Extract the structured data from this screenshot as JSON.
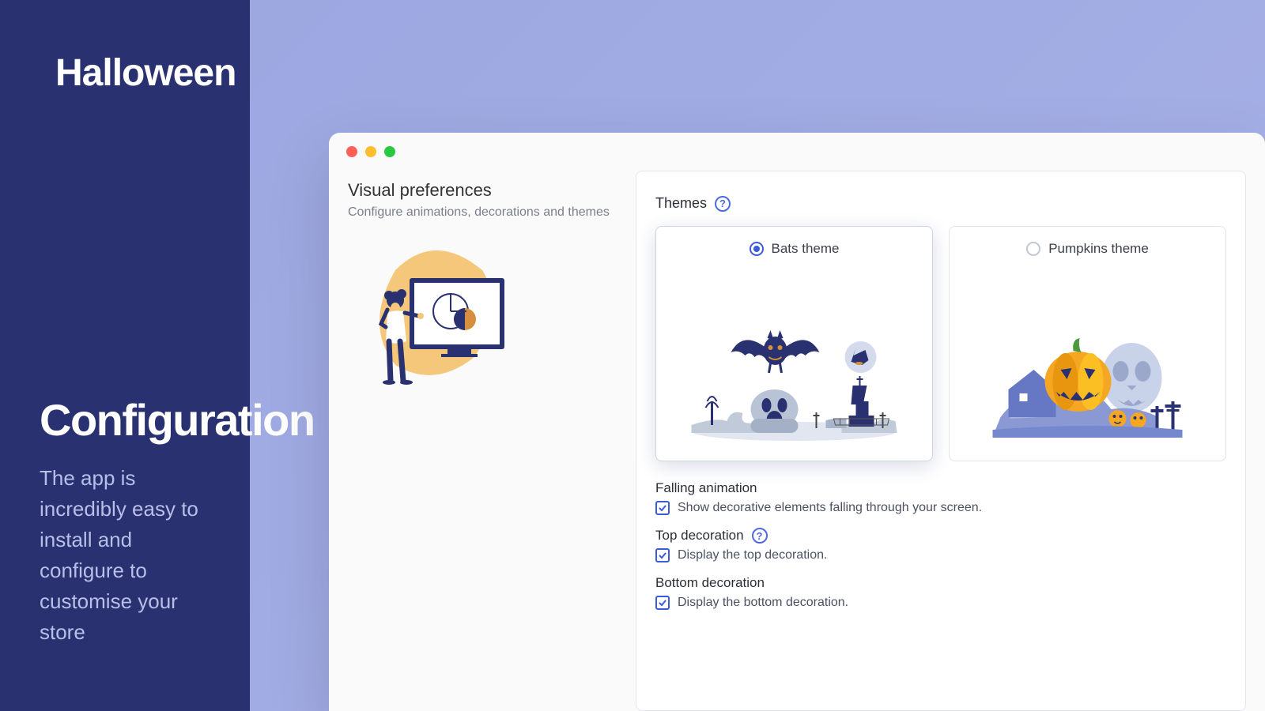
{
  "brand": {
    "title": "Halloween"
  },
  "config": {
    "title": "Configuration",
    "description": "The app is incredibly easy to install and configure to customise your store"
  },
  "visualPrefs": {
    "title": "Visual preferences",
    "subtitle": "Configure animations, decorations and themes"
  },
  "panel": {
    "themesLabel": "Themes",
    "themes": [
      {
        "label": "Bats theme",
        "selected": true
      },
      {
        "label": "Pumpkins theme",
        "selected": false
      }
    ],
    "falling": {
      "label": "Falling animation",
      "checkLabel": "Show decorative elements falling through your screen."
    },
    "top": {
      "label": "Top decoration",
      "checkLabel": "Display the top decoration."
    },
    "bottom": {
      "label": "Bottom decoration",
      "checkLabel": "Display the bottom decoration."
    }
  }
}
